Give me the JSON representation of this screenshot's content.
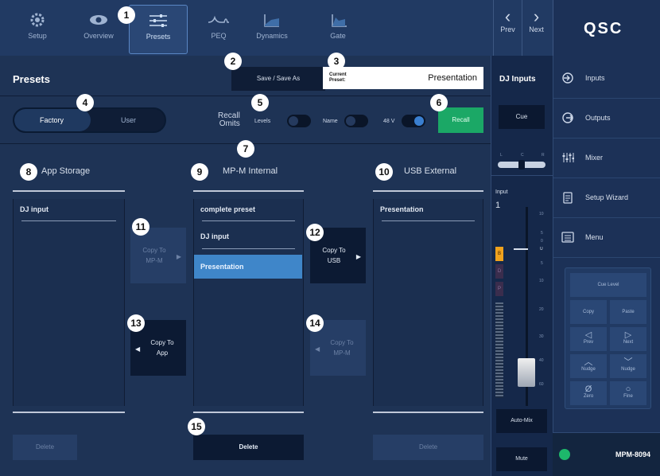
{
  "nav": {
    "tabs": [
      {
        "label": "Setup",
        "icon": "gear-icon"
      },
      {
        "label": "Overview",
        "icon": "eye-icon"
      },
      {
        "label": "Presets",
        "icon": "sliders-icon"
      },
      {
        "label": "PEQ",
        "icon": "peq-curve-icon"
      },
      {
        "label": "Dynamics",
        "icon": "dynamics-icon"
      },
      {
        "label": "Gate",
        "icon": "gate-icon"
      }
    ],
    "prev": "Prev",
    "next": "Next",
    "brand": "QSC"
  },
  "presets": {
    "title": "Presets",
    "save_label": "Save / Save As",
    "current_label": "Current\nPreset:",
    "current_value": "Presentation",
    "factory_label": "Factory",
    "user_label": "User",
    "recall_omits_label": "Recall\nOmits",
    "levels_label": "Levels",
    "name_label": "Name",
    "phantom_label": "48 V",
    "recall_label": "Recall"
  },
  "columns": {
    "app": {
      "title": "App Storage",
      "items": [
        "DJ input"
      ],
      "delete": "Delete"
    },
    "mpm": {
      "title": "MP-M Internal",
      "items": [
        "complete preset",
        "DJ input"
      ],
      "selected": "Presentation",
      "delete": "Delete"
    },
    "usb": {
      "title": "USB External",
      "items": [
        "Presentation"
      ],
      "delete": "Delete"
    }
  },
  "copy": {
    "to_mpm_top": "Copy To\nMP-M",
    "to_usb": "Copy To\nUSB",
    "to_app": "Copy To\nApp",
    "to_mpm_bottom": "Copy To\nMP-M"
  },
  "dj": {
    "title": "DJ Inputs",
    "cue": "Cue",
    "pan_ticks": [
      "L",
      "C",
      "R"
    ],
    "input_label": "Input",
    "input_number": "1",
    "level_ticks": [
      "10",
      "5",
      "0",
      "5",
      "10",
      "20",
      "30",
      "40",
      "60"
    ],
    "unity": "U",
    "channel_tags": [
      "B",
      "D",
      "P"
    ],
    "automix": "Auto-Mix",
    "mute": "Mute"
  },
  "side": {
    "items": [
      {
        "label": "Inputs",
        "icon": "input-icon"
      },
      {
        "label": "Outputs",
        "icon": "output-icon"
      },
      {
        "label": "Mixer",
        "icon": "mixer-icon"
      },
      {
        "label": "Setup Wizard",
        "icon": "wizard-icon"
      },
      {
        "label": "Menu",
        "icon": "menu-icon"
      }
    ],
    "keypad": {
      "cue_level": "Cue Level",
      "copy": "Copy",
      "paste": "Paste",
      "prev": "Prev",
      "next": "Next",
      "nudge_down": "Nudge",
      "nudge_up": "Nudge",
      "zero": "Zero",
      "fine": "Fine"
    },
    "model": "MPM-8094"
  },
  "callouts": [
    "1",
    "2",
    "3",
    "4",
    "5",
    "6",
    "7",
    "8",
    "9",
    "10",
    "11",
    "12",
    "13",
    "14",
    "15"
  ],
  "colors": {
    "accent": "#3f86c9",
    "recall": "#1ba866",
    "background": "#1e3355"
  }
}
